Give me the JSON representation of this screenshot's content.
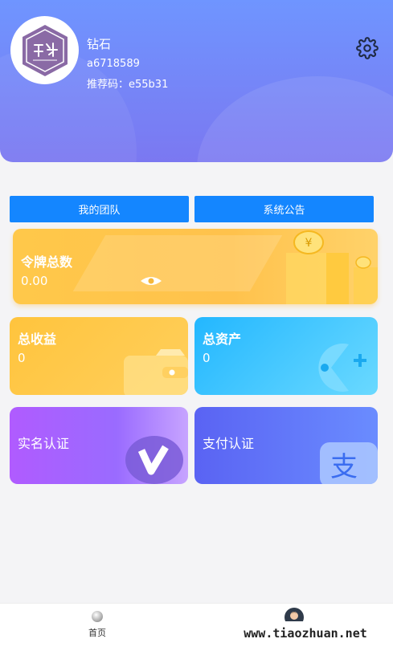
{
  "header": {
    "level": "钻石",
    "user_id": "a6718589",
    "referral": "推荐码：e55b31",
    "settings_icon": "gear-icon",
    "avatar_icon": "shop-logo-icon"
  },
  "actions": {
    "team_label": "我的团队",
    "notice_label": "系统公告"
  },
  "token_card": {
    "title": "令牌总数",
    "value": "0.00",
    "visibility_icon": "eye-icon",
    "illustration": "coin-stack-icon"
  },
  "income_card": {
    "title": "总收益",
    "value": "0",
    "icon": "wallet-icon"
  },
  "assets_card": {
    "title": "总资产",
    "value": "0",
    "icon": "gamepad-icon"
  },
  "realname_card": {
    "title": "实名认证",
    "icon": "verified-v-icon"
  },
  "payment_card": {
    "title": "支付认证",
    "icon": "alipay-icon"
  },
  "tabbar": {
    "home_label": "首页",
    "home_icon": "home-ball-icon",
    "me_icon": "user-avatar-icon"
  },
  "watermark": "www.tiaozhuan.net",
  "colors": {
    "header_top": "#6f95ff",
    "header_bottom": "#7b78f1",
    "button_blue": "#1486ff",
    "token_yellow": "#ffc84a",
    "assets_blue": "#23b7ff",
    "realname_purple": "#b05bff",
    "payment_blue": "#5a63f3"
  }
}
